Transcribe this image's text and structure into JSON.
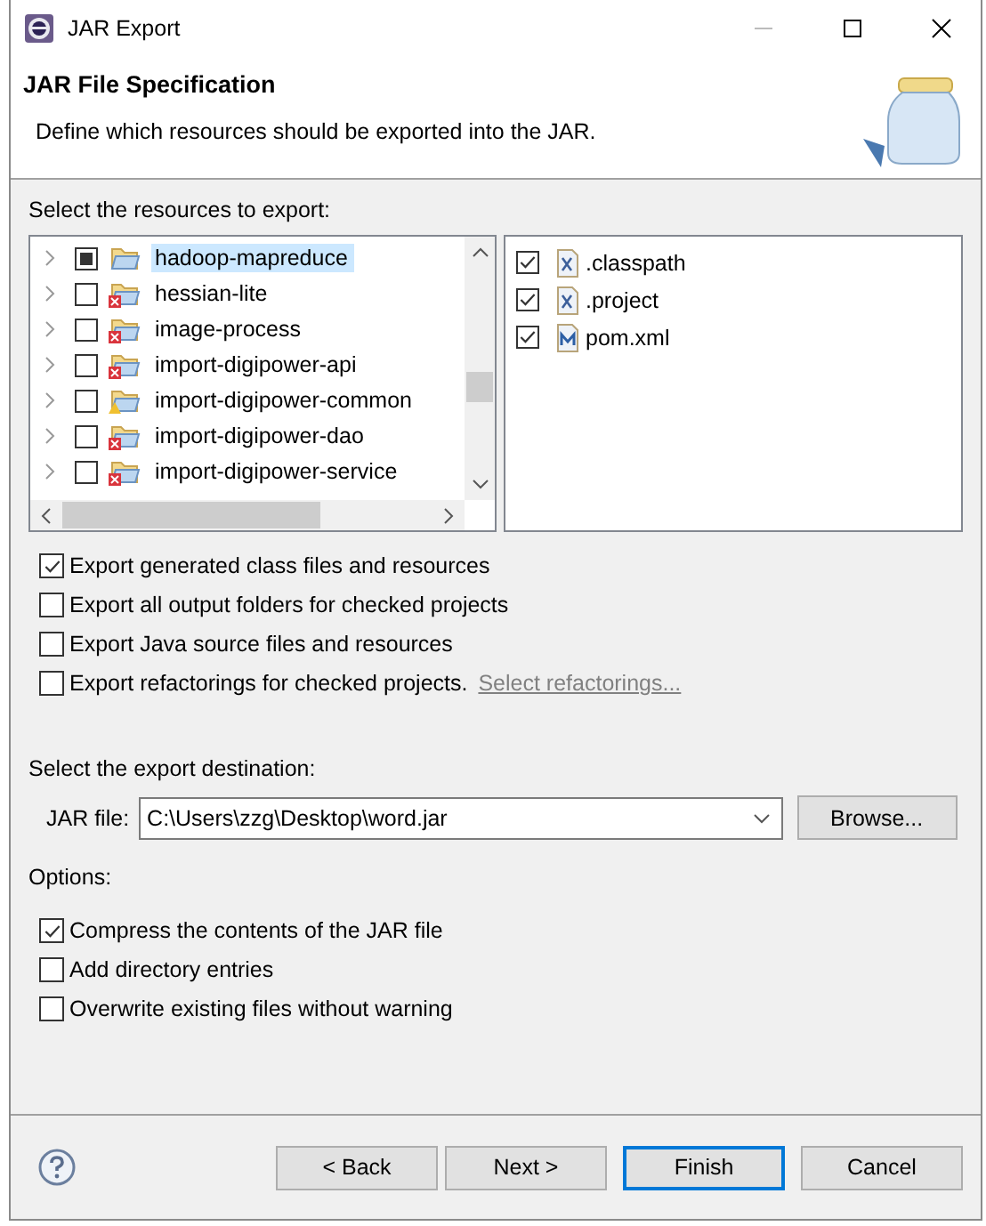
{
  "window": {
    "title": "JAR Export"
  },
  "header": {
    "title": "JAR File Specification",
    "description": "Define which resources should be exported into the JAR."
  },
  "resources": {
    "label": "Select the resources to export:",
    "projects": [
      {
        "name": "hadoop-mapreduce",
        "checked": false,
        "partial": true,
        "selected": true,
        "error": false,
        "warning": false
      },
      {
        "name": "hessian-lite",
        "checked": false,
        "partial": false,
        "selected": false,
        "error": true,
        "warning": false
      },
      {
        "name": "image-process",
        "checked": false,
        "partial": false,
        "selected": false,
        "error": true,
        "warning": false
      },
      {
        "name": "import-digipower-api",
        "checked": false,
        "partial": false,
        "selected": false,
        "error": true,
        "warning": false
      },
      {
        "name": "import-digipower-common",
        "checked": false,
        "partial": false,
        "selected": false,
        "error": false,
        "warning": true
      },
      {
        "name": "import-digipower-dao",
        "checked": false,
        "partial": false,
        "selected": false,
        "error": true,
        "warning": false
      },
      {
        "name": "import-digipower-service",
        "checked": false,
        "partial": false,
        "selected": false,
        "error": true,
        "warning": false
      }
    ],
    "files": [
      {
        "name": ".classpath",
        "checked": true,
        "kind": "xml"
      },
      {
        "name": ".project",
        "checked": true,
        "kind": "xml"
      },
      {
        "name": "pom.xml",
        "checked": true,
        "kind": "maven"
      }
    ]
  },
  "export_options": [
    {
      "label": "Export generated class files and resources",
      "checked": true
    },
    {
      "label": "Export all output folders for checked projects",
      "checked": false
    },
    {
      "label": "Export Java source files and resources",
      "checked": false
    },
    {
      "label": "Export refactorings for checked projects.",
      "checked": false,
      "link": "Select refactorings..."
    }
  ],
  "destination": {
    "label": "Select the export destination:",
    "field_label": "JAR file:",
    "value": "C:\\Users\\zzg\\Desktop\\word.jar",
    "browse": "Browse..."
  },
  "options": {
    "label": "Options:",
    "items": [
      {
        "label": "Compress the contents of the JAR file",
        "checked": true
      },
      {
        "label": "Add directory entries",
        "checked": false
      },
      {
        "label": "Overwrite existing files without warning",
        "checked": false
      }
    ]
  },
  "buttons": [
    {
      "label": "< Back",
      "default": false
    },
    {
      "label": "Next >",
      "default": false
    },
    {
      "label": "Finish",
      "default": true
    },
    {
      "label": "Cancel",
      "default": false
    }
  ]
}
